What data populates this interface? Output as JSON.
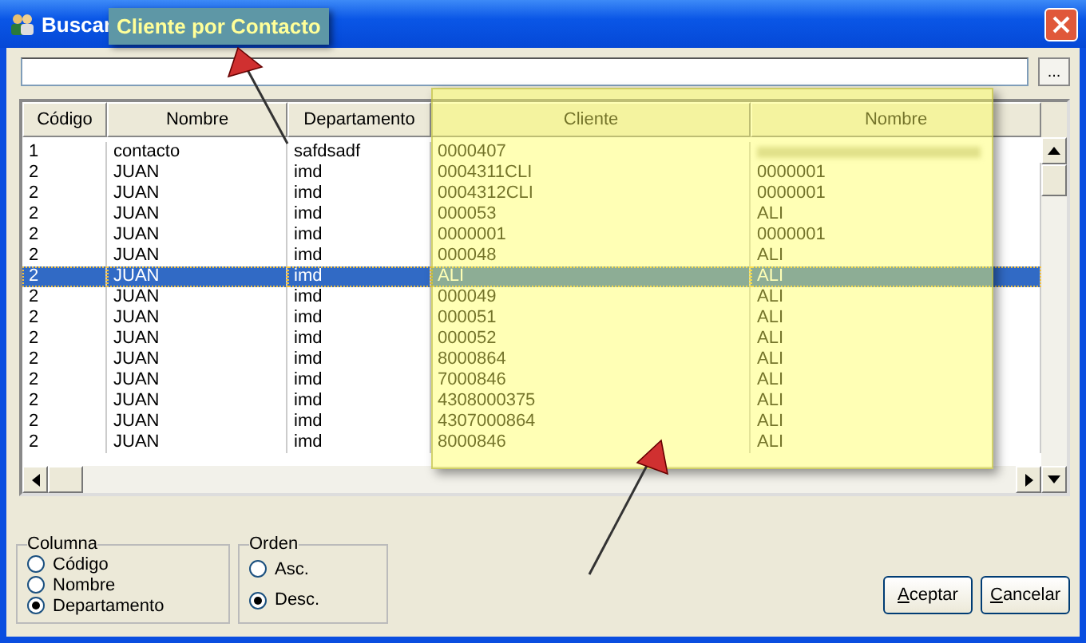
{
  "window": {
    "title": "Buscar"
  },
  "callout": {
    "text": "Cliente por Contacto"
  },
  "browse_button": "...",
  "table": {
    "columns": [
      "Código",
      "Nombre",
      "Departamento",
      "Cliente",
      "Nombre"
    ],
    "rows": [
      {
        "codigo": "1",
        "nombre": "contacto",
        "departamento": "safdsadf",
        "cliente": "0000407",
        "cliente_nombre_blurred": true,
        "selected": false
      },
      {
        "codigo": "2",
        "nombre": "JUAN",
        "departamento": "imd",
        "cliente": "0004311CLI",
        "cliente_nombre": "0000001",
        "cliente_nombre_blurred": false,
        "selected": false
      },
      {
        "codigo": "2",
        "nombre": "JUAN",
        "departamento": "imd",
        "cliente": "0004312CLI",
        "cliente_nombre": "0000001",
        "cliente_nombre_blurred": false,
        "selected": false
      },
      {
        "codigo": "2",
        "nombre": "JUAN",
        "departamento": "imd",
        "cliente": "000053",
        "cliente_nombre": "ALI",
        "cliente_nombre_blurred": false,
        "selected": false
      },
      {
        "codigo": "2",
        "nombre": "JUAN",
        "departamento": "imd",
        "cliente": "0000001",
        "cliente_nombre": "0000001",
        "cliente_nombre_blurred": false,
        "selected": false
      },
      {
        "codigo": "2",
        "nombre": "JUAN",
        "departamento": "imd",
        "cliente": "000048",
        "cliente_nombre": "ALI",
        "cliente_nombre_blurred": false,
        "selected": false
      },
      {
        "codigo": "2",
        "nombre": "JUAN",
        "departamento": "imd",
        "cliente": "ALI",
        "cliente_nombre": "ALI",
        "cliente_nombre_blurred": false,
        "selected": true
      },
      {
        "codigo": "2",
        "nombre": "JUAN",
        "departamento": "imd",
        "cliente": "000049",
        "cliente_nombre": "ALI",
        "cliente_nombre_blurred": false,
        "selected": false
      },
      {
        "codigo": "2",
        "nombre": "JUAN",
        "departamento": "imd",
        "cliente": "000051",
        "cliente_nombre": "ALI",
        "cliente_nombre_blurred": false,
        "selected": false
      },
      {
        "codigo": "2",
        "nombre": "JUAN",
        "departamento": "imd",
        "cliente": "000052",
        "cliente_nombre": "ALI",
        "cliente_nombre_blurred": false,
        "selected": false
      },
      {
        "codigo": "2",
        "nombre": "JUAN",
        "departamento": "imd",
        "cliente": "8000864",
        "cliente_nombre": "ALI",
        "cliente_nombre_blurred": false,
        "selected": false
      },
      {
        "codigo": "2",
        "nombre": "JUAN",
        "departamento": "imd",
        "cliente": "7000846",
        "cliente_nombre": "ALI",
        "cliente_nombre_blurred": false,
        "selected": false
      },
      {
        "codigo": "2",
        "nombre": "JUAN",
        "departamento": "imd",
        "cliente": "4308000375",
        "cliente_nombre": "ALI",
        "cliente_nombre_blurred": false,
        "selected": false
      },
      {
        "codigo": "2",
        "nombre": "JUAN",
        "departamento": "imd",
        "cliente": "4307000864",
        "cliente_nombre": "ALI",
        "cliente_nombre_blurred": false,
        "selected": false
      },
      {
        "codigo": "2",
        "nombre": "JUAN",
        "departamento": "imd",
        "cliente": "8000846",
        "cliente_nombre": "ALI",
        "cliente_nombre_blurred": false,
        "selected": false
      }
    ]
  },
  "column_group": {
    "title": "Columna",
    "options": [
      {
        "label": "Código",
        "selected": false
      },
      {
        "label": "Nombre",
        "selected": false
      },
      {
        "label": "Departamento",
        "selected": true
      }
    ]
  },
  "order_group": {
    "title": "Orden",
    "options": [
      {
        "label": "Asc.",
        "selected": false
      },
      {
        "label": "Desc.",
        "selected": true
      }
    ]
  },
  "buttons": [
    {
      "label": "Aceptar"
    },
    {
      "label": "Cancelar"
    }
  ]
}
